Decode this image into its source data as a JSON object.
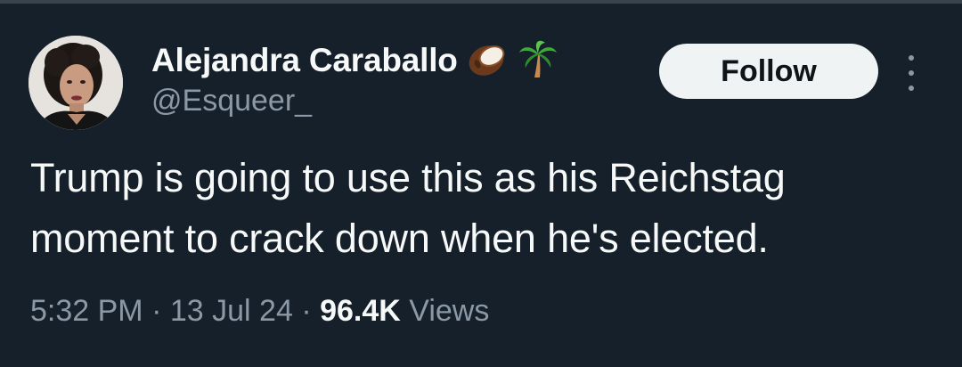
{
  "author": {
    "display_name": "Alejandra Caraballo",
    "handle": "@Esqueer_",
    "name_emojis": [
      "coconut-emoji",
      "palm-tree-emoji"
    ]
  },
  "actions": {
    "follow_label": "Follow",
    "more_icon": "more-vertical-icon"
  },
  "tweet": {
    "line1": "Trump is going to use this as his Reichstag",
    "line2": "moment to crack down when he's elected."
  },
  "meta": {
    "time": "5:32 PM",
    "separator": "·",
    "date": "13 Jul 24",
    "views_count": "96.4K",
    "views_label": "Views"
  },
  "colors": {
    "background": "#15202b",
    "primary_text": "#f7f9f9",
    "secondary_text": "#8b98a5",
    "follow_bg": "#eff3f4",
    "follow_text": "#0f1419"
  }
}
